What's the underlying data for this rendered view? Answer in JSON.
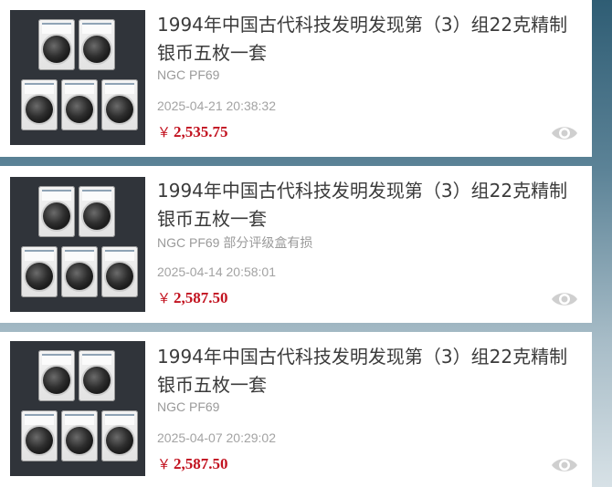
{
  "listings": [
    {
      "title": "1994年中国古代科技发明发现第（3）组22克精制银币五枚一套",
      "grade": "NGC PF69",
      "date": "2025-04-21 20:38:32",
      "currency": "￥",
      "price": "2,535.75"
    },
    {
      "title": "1994年中国古代科技发明发现第（3）组22克精制银币五枚一套",
      "grade": "NGC PF69 部分评级盒有损",
      "date": "2025-04-14 20:58:01",
      "currency": "￥",
      "price": "2,587.50"
    },
    {
      "title": "1994年中国古代科技发明发现第（3）组22克精制银币五枚一套",
      "grade": "NGC PF69",
      "date": "2025-04-07 20:29:02",
      "currency": "￥",
      "price": "2,587.50"
    }
  ],
  "colors": {
    "price": "#c2121f",
    "title": "#3b3b3b",
    "meta": "#9a9a9a",
    "background_top": "#2f5d74"
  },
  "icons": {
    "view": "eye-icon"
  }
}
